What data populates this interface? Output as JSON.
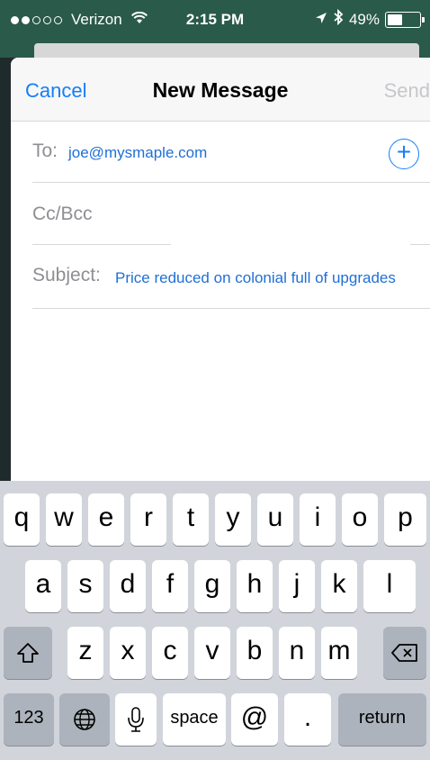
{
  "status_bar": {
    "carrier": "Verizon",
    "time": "2:15 PM",
    "battery": "49%",
    "battery_level": 0.49,
    "signal_bars_filled": 2,
    "signal_bars_total": 5,
    "icons": [
      "signal-dots-icon",
      "wifi-icon",
      "location-arrow-icon",
      "bluetooth-icon",
      "battery-icon"
    ]
  },
  "compose": {
    "cancel_label": "Cancel",
    "title": "New Message",
    "send_label": "Send",
    "to_label": "To:",
    "to_value": "joe@mysmaple.com",
    "add_recipient_icon": "plus-circle-icon",
    "cc_label": "Cc/Bcc",
    "subject_label": "Subject:",
    "subject_value": "Price reduced on colonial full of upgrades"
  },
  "keyboard": {
    "row1": [
      "q",
      "w",
      "e",
      "r",
      "t",
      "y",
      "u",
      "i",
      "o",
      "p"
    ],
    "row2": [
      "a",
      "s",
      "d",
      "f",
      "g",
      "h",
      "j",
      "k",
      "l"
    ],
    "row3": [
      "z",
      "x",
      "c",
      "v",
      "b",
      "n",
      "m"
    ],
    "numbers_label": "123",
    "space_label": "space",
    "at_label": "@",
    "period_label": ".",
    "return_label": "return",
    "shift_icon": "shift-icon",
    "delete_icon": "delete-icon",
    "globe_icon": "globe-icon",
    "mic_icon": "microphone-icon"
  },
  "colors": {
    "accent": "#147efb",
    "status_bar_bg": "#2a5a4a",
    "keyboard_bg": "#d1d5db",
    "link_text": "#1f6fd6",
    "placeholder_gray": "#8e8e93"
  }
}
